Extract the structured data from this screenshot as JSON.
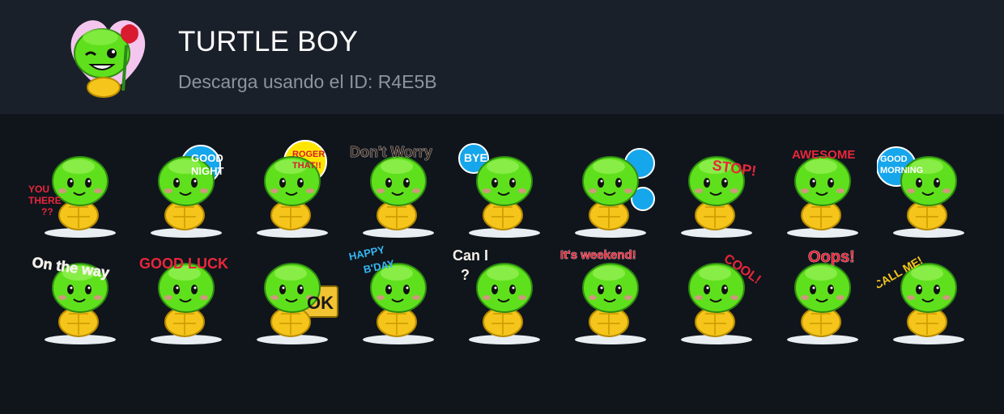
{
  "pack": {
    "title": "TURTLE BOY",
    "subtitle": "Descarga usando el ID: R4E5B",
    "icon": "turtle-with-rose-heart-icon"
  },
  "colors": {
    "header_bg": "#1a2029",
    "body_bg": "#10151c",
    "title": "#ffffff",
    "subtitle": "#8d949d",
    "turtle_green": "#5fe01c",
    "shell_yellow": "#f5c51b"
  },
  "stickers": [
    {
      "name": "sticker-you-there",
      "caption": [
        "YOU",
        "THERE",
        "??"
      ]
    },
    {
      "name": "sticker-good-night",
      "caption": [
        "GOOD",
        "NIGHT"
      ]
    },
    {
      "name": "sticker-roger-that",
      "caption": [
        "ROGER",
        "THAT!!"
      ]
    },
    {
      "name": "sticker-dont-worry",
      "caption": [
        "Don't Worry"
      ]
    },
    {
      "name": "sticker-bye",
      "caption": [
        "BYE"
      ]
    },
    {
      "name": "sticker-question",
      "caption": [
        "?",
        "?"
      ]
    },
    {
      "name": "sticker-stop",
      "caption": [
        "STOP!"
      ]
    },
    {
      "name": "sticker-awesome",
      "caption": [
        "AWESOME"
      ]
    },
    {
      "name": "sticker-good-morning",
      "caption": [
        "GOOD",
        "MORNING"
      ]
    },
    {
      "name": "sticker-on-the-way",
      "caption": [
        "On the way"
      ]
    },
    {
      "name": "sticker-good-luck",
      "caption": [
        "GOOD LUCK"
      ]
    },
    {
      "name": "sticker-ok",
      "caption": [
        "OK"
      ]
    },
    {
      "name": "sticker-happy-bday",
      "caption": [
        "HAPPY",
        "B'DAY"
      ]
    },
    {
      "name": "sticker-can-i",
      "caption": [
        "Can I",
        "?"
      ]
    },
    {
      "name": "sticker-its-weekend",
      "caption": [
        "It's weekend!"
      ]
    },
    {
      "name": "sticker-cool",
      "caption": [
        "COOL!"
      ]
    },
    {
      "name": "sticker-oops",
      "caption": [
        "Oops!"
      ]
    },
    {
      "name": "sticker-call-me",
      "caption": [
        "CALL ME!"
      ]
    }
  ]
}
